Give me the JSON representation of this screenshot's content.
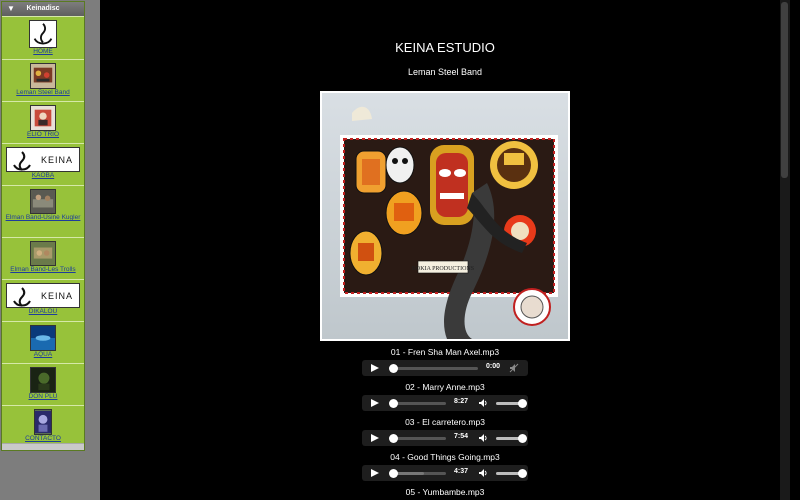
{
  "sidebar": {
    "title": "Keinadisc",
    "items": [
      {
        "label": "HOME",
        "icon": "keina-logo-icon"
      },
      {
        "label": "Leman Steel Band",
        "icon": "leman-steel-band-thumbnail"
      },
      {
        "label": "ELIO TRIO",
        "icon": "elio-trio-thumbnail"
      },
      {
        "label": "KAOBA",
        "icon": "kaoba-keina-logo",
        "logo_text": "KEINA"
      },
      {
        "label": "Elman Band-Usine Kugler",
        "icon": "elman-usine-thumbnail"
      },
      {
        "label": "Elman Band-Les Trolls",
        "icon": "elman-trolls-thumbnail"
      },
      {
        "label": "DIKALOU",
        "icon": "dikalou-keina-logo",
        "logo_text": "KEINA"
      },
      {
        "label": "AQUA",
        "icon": "aqua-thumbnail"
      },
      {
        "label": "DON PLU",
        "icon": "don-plu-thumbnail"
      },
      {
        "label": "CONTACTO",
        "icon": "contacto-thumbnail"
      }
    ]
  },
  "main": {
    "title": "KEINA ESTUDIO",
    "album": "Leman Steel Band",
    "cover_text": "ROKIA PRODUCTIONS"
  },
  "tracks": [
    {
      "title": "01 - Fren Sha Man Axel.mp3",
      "time": "0:00",
      "muted": true
    },
    {
      "title": "02 - Marry Anne.mp3",
      "time": "8:27",
      "muted": false
    },
    {
      "title": "03 - El carretero.mp3",
      "time": "7:54",
      "muted": false
    },
    {
      "title": "04 - Good Things Going.mp3",
      "time": "4:37",
      "muted": false
    },
    {
      "title": "05 - Yumbambe.mp3"
    }
  ],
  "colors": {
    "sidebar": "#97c23a",
    "link": "#1e3d9c",
    "background": "#000000"
  }
}
